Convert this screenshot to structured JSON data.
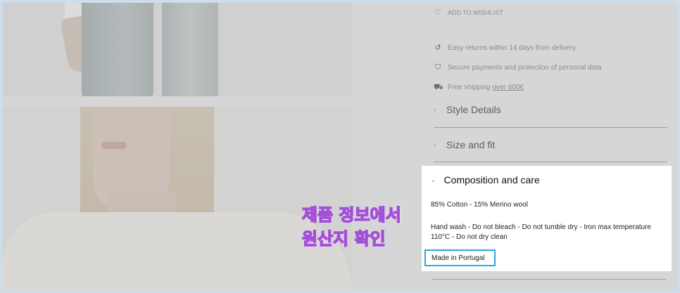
{
  "wishlist": {
    "label": "ADD TO WISHLIST",
    "icon": "heart-icon"
  },
  "benefits": [
    {
      "icon": "return-icon",
      "text": "Easy returns within 14 days from delivery"
    },
    {
      "icon": "shield-icon",
      "text": "Secure payments and protection of personal data"
    },
    {
      "icon": "truck-icon",
      "text": "Free shipping",
      "link": "over 600€"
    }
  ],
  "accordion": {
    "style_details": "Style Details",
    "size_fit": "Size and fit",
    "composition": {
      "title": "Composition and care",
      "material": "85% Cotton - 15% Merino wool",
      "care": "Hand wash - Do not bleach - Do not tumble dry - Iron max temperature 110°C - Do not dry clean",
      "origin": "Made in Portugal"
    }
  },
  "overlay": {
    "line1": "제품 정보에서",
    "line2": "원산지 확인"
  },
  "colors": {
    "highlight": "#2aa7e0",
    "overlay_text": "#d59ff0"
  }
}
